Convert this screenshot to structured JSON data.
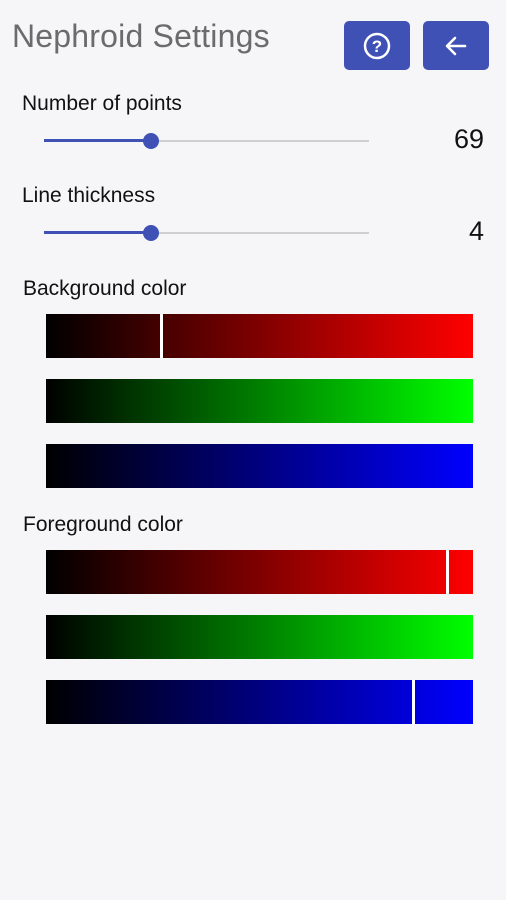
{
  "header": {
    "title": "Nephroid Settings",
    "help_button_icon": "help-circle-icon",
    "back_button_icon": "arrow-left-icon",
    "accent_color": "#3f51b5"
  },
  "points": {
    "label": "Number of points",
    "value": "69",
    "level": 0.33
  },
  "thickness": {
    "label": "Line thickness",
    "value": "4",
    "level": 0.33
  },
  "background": {
    "label": "Background color",
    "red": 0.27,
    "green": 0.0,
    "blue": 0.0
  },
  "foreground": {
    "label": "Foreground color",
    "red": 0.94,
    "green": 1.0,
    "blue": 0.86
  }
}
